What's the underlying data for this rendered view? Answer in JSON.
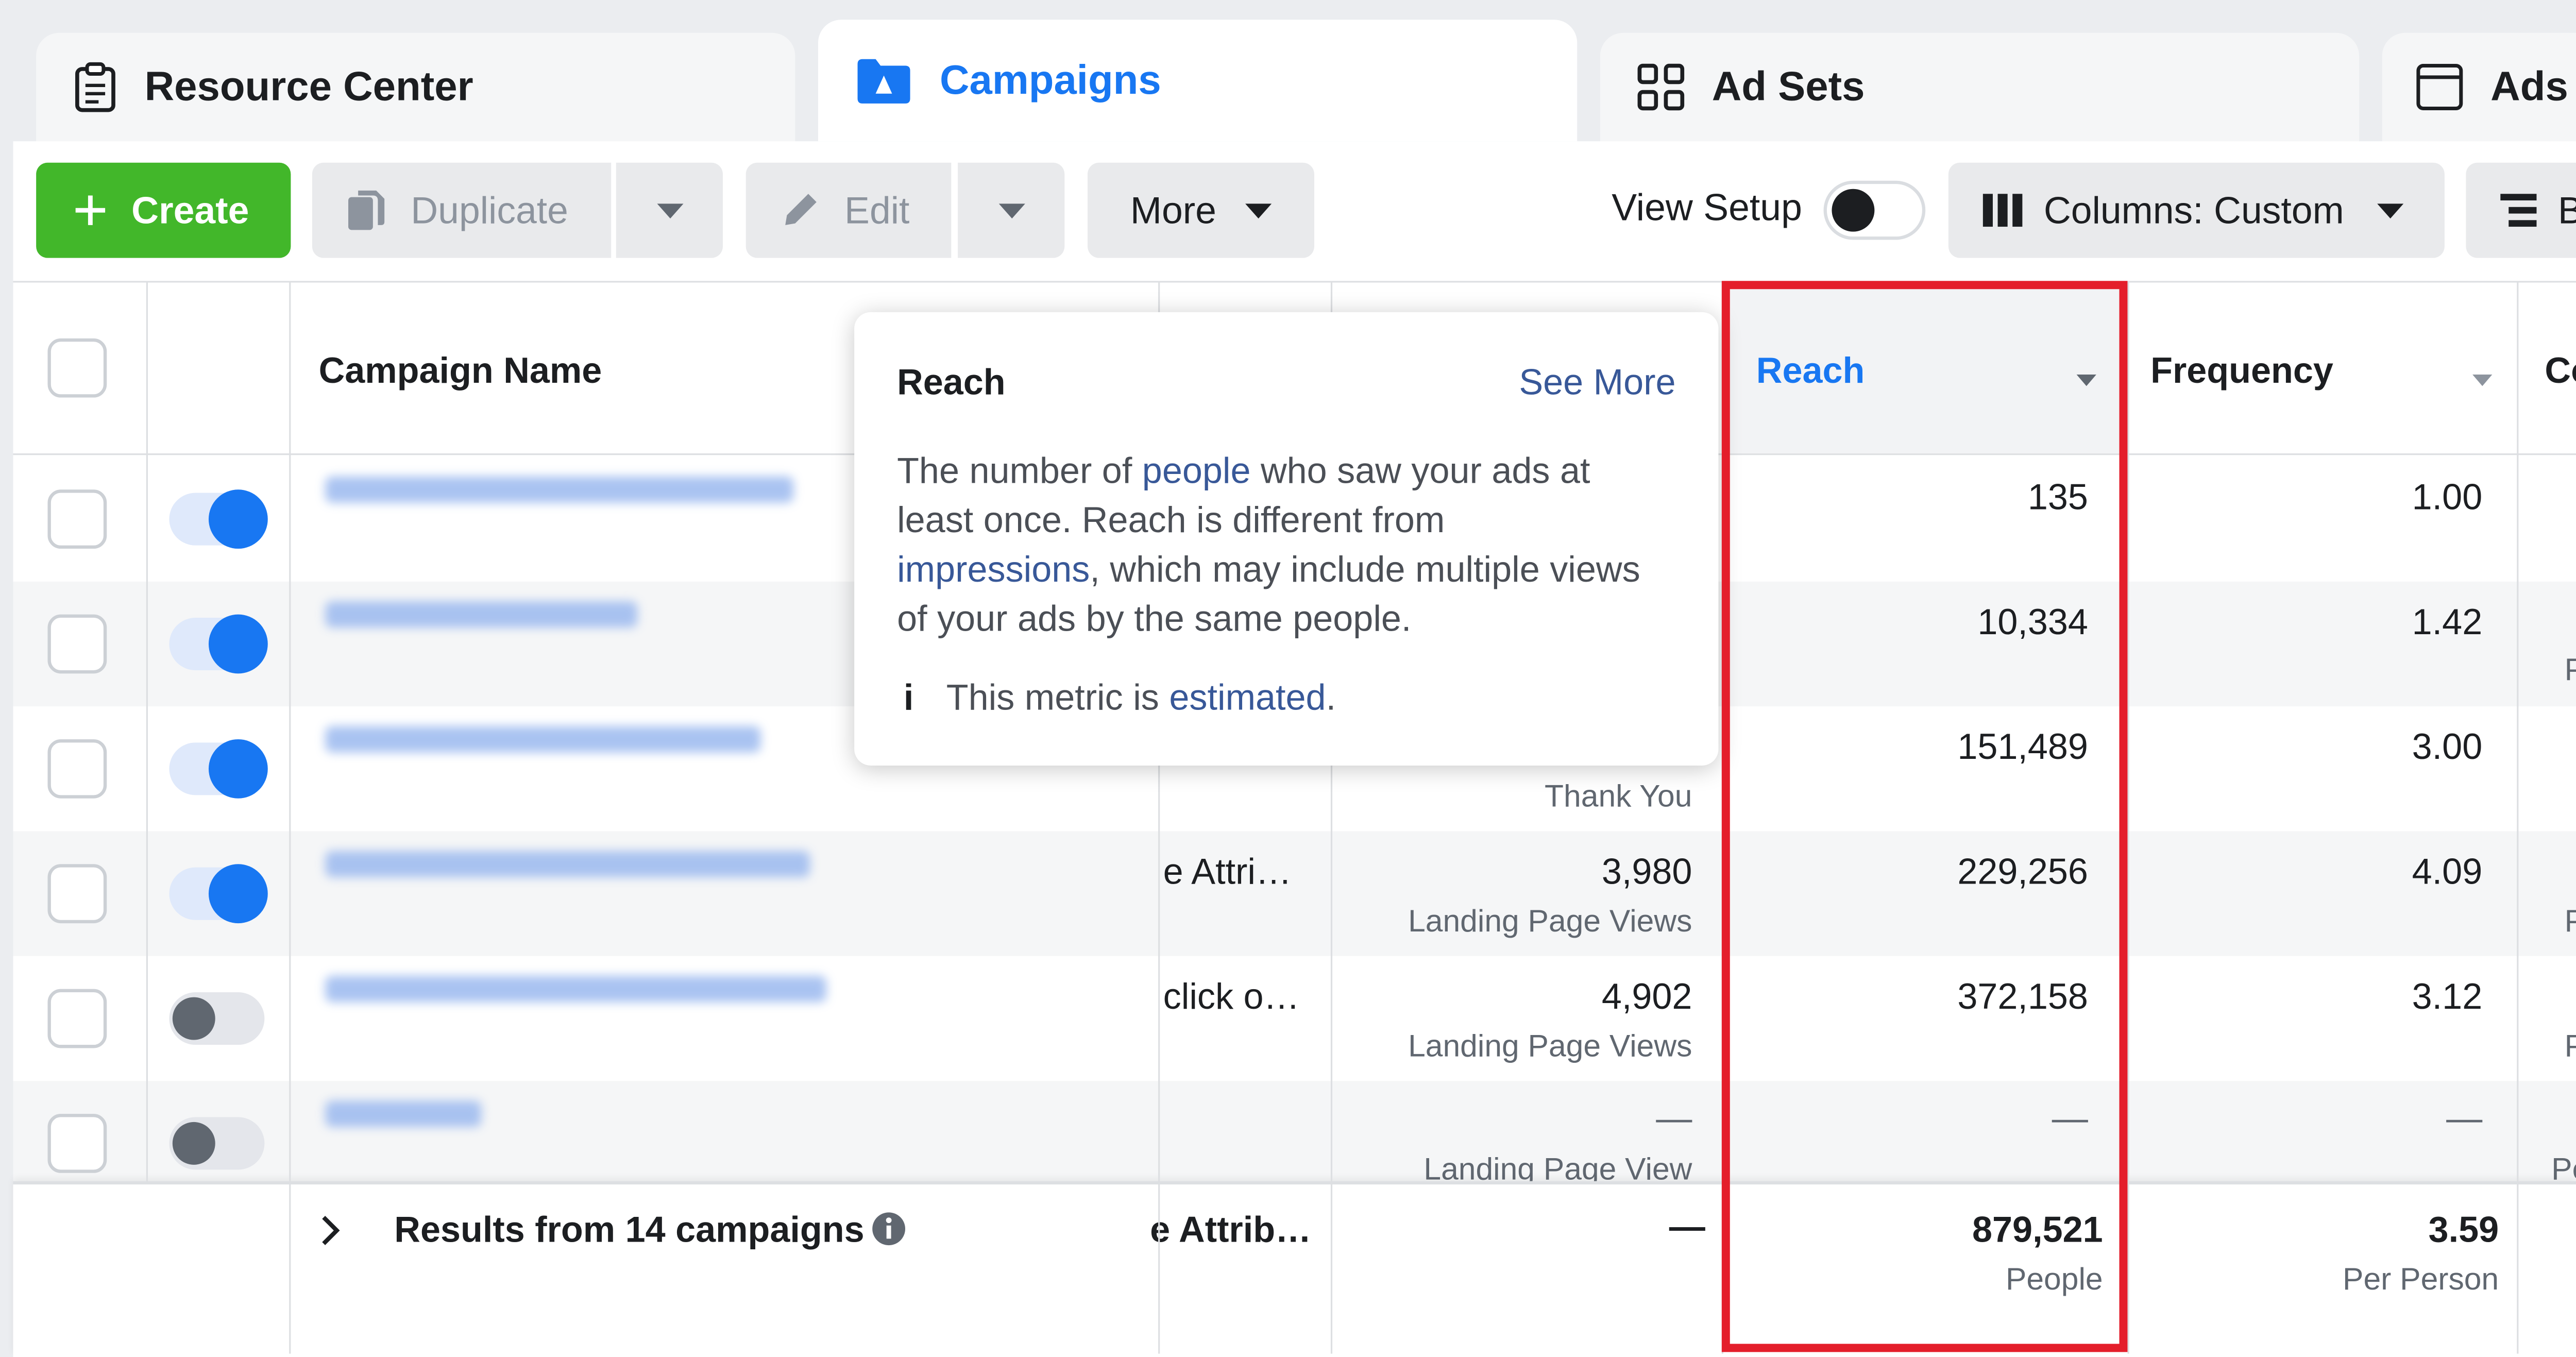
{
  "tabs": [
    {
      "label": "Resource Center",
      "icon": "clipboard-icon"
    },
    {
      "label": "Campaigns",
      "icon": "folder-icon"
    },
    {
      "label": "Ad Sets",
      "icon": "grid-icon"
    },
    {
      "label": "Ads",
      "icon": "ad-window-icon"
    }
  ],
  "toolbar": {
    "create": "Create",
    "duplicate": "Duplicate",
    "edit": "Edit",
    "more": "More",
    "view_setup": "View Setup",
    "columns": "Columns: Custom",
    "breakdown_partial": "B"
  },
  "table": {
    "headers": {
      "campaign_name": "Campaign Name",
      "reach": "Reach",
      "frequency": "Frequency",
      "next_partial": "Co"
    },
    "rows": [
      {
        "toggle": "on",
        "attribution": "",
        "results": "",
        "results_sub": "",
        "reach": "135",
        "frequency": "1.00",
        "freq_sub": ""
      },
      {
        "toggle": "on",
        "attribution": "",
        "results": "",
        "results_sub": "",
        "reach": "10,334",
        "frequency": "1.42",
        "freq_sub": "P"
      },
      {
        "toggle": "on",
        "attribution": "",
        "results": "",
        "results_sub": "Thank You",
        "reach": "151,489",
        "frequency": "3.00",
        "freq_sub": ""
      },
      {
        "toggle": "on",
        "attribution": "e Attri…",
        "results": "3,980",
        "results_sub": "Landing Page Views",
        "reach": "229,256",
        "frequency": "4.09",
        "freq_sub": "Pe"
      },
      {
        "toggle": "off",
        "attribution": "click o…",
        "results": "4,902",
        "results_sub": "Landing Page Views",
        "reach": "372,158",
        "frequency": "3.12",
        "freq_sub": "Pe"
      },
      {
        "toggle": "off",
        "attribution": "",
        "results": "—",
        "results_sub": "Landing Page View",
        "reach": "—",
        "frequency": "—",
        "freq_sub": "Pe"
      }
    ],
    "summary": {
      "label": "Results from 14 campaigns",
      "attribution": "e Attrib…",
      "results": "—",
      "reach": "879,521",
      "reach_sub": "People",
      "frequency": "3.59",
      "frequency_sub": "Per Person"
    }
  },
  "tooltip": {
    "title": "Reach",
    "see_more": "See More",
    "t1": "The number of ",
    "l1": "people",
    "t2": " who saw your ads at least once. Reach is different from ",
    "l2": "impressions",
    "t3": ", which may include multiple views of your ads by the same people.",
    "note_pre": "This metric is ",
    "note_link": "estimated",
    "note_post": "."
  },
  "colors": {
    "accent_blue": "#1877f2",
    "create_green": "#42b72a",
    "highlight_red": "#e41e2b",
    "link_blue": "#385898"
  }
}
